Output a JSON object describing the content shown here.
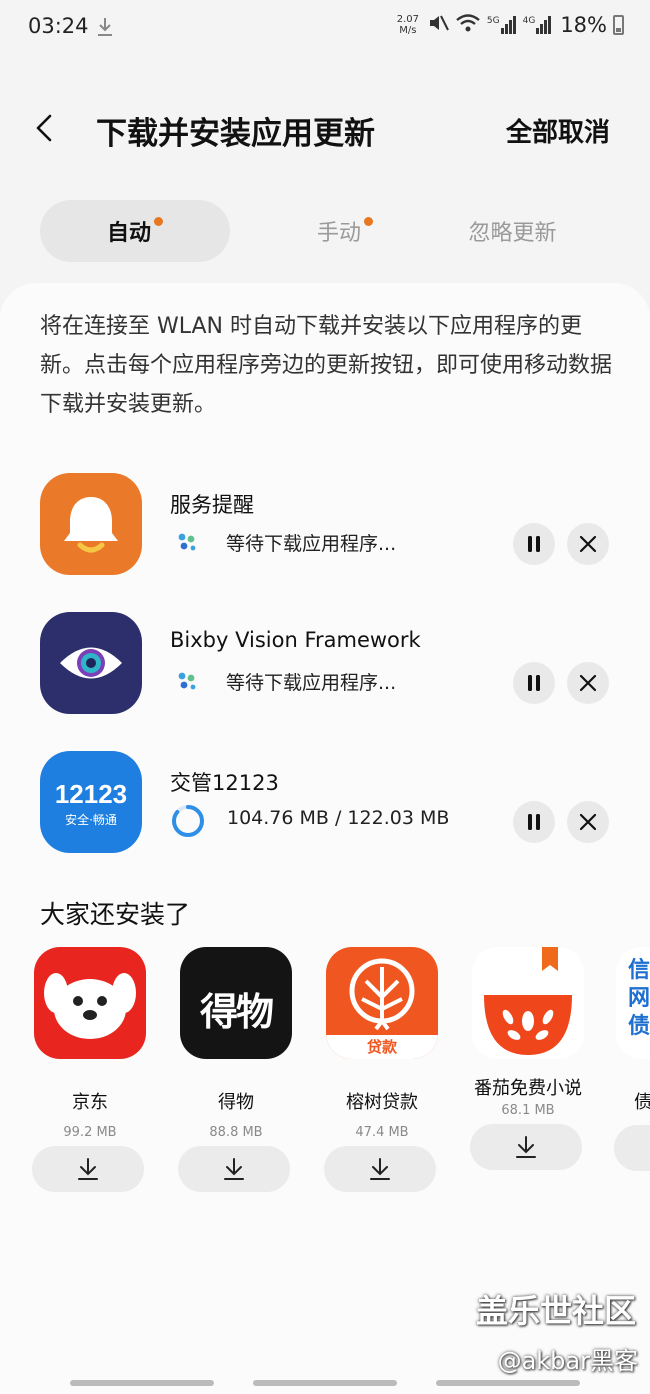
{
  "status_bar": {
    "time": "03:24",
    "speed_value": "2.07",
    "speed_unit": "M/s",
    "network_5g": "5G",
    "network_4g": "4G",
    "battery": "18%"
  },
  "header": {
    "title": "下载并安装应用更新",
    "cancel_all": "全部取消"
  },
  "tabs": [
    {
      "label": "自动",
      "active": true,
      "dot": true
    },
    {
      "label": "手动",
      "active": false,
      "dot": true
    },
    {
      "label": "忽略更新",
      "active": false,
      "dot": false
    }
  ],
  "description": "将在连接至 WLAN 时自动下载并安装以下应用程序的更新。点击每个应用程序旁边的更新按钮，即可使用移动数据下载并安装更新。",
  "updates": [
    {
      "name": "服务提醒",
      "status": "等待下载应用程序..."
    },
    {
      "name": "Bixby Vision Framework",
      "status": "等待下载应用程序..."
    },
    {
      "name": "交管12123",
      "status": "104.76 MB / 122.03 MB",
      "progress": 0.86
    }
  ],
  "icon_texts": {
    "jiaoguan_top": "12123",
    "jiaoguan_bottom": "安全·畅通",
    "dewu": "得物",
    "rongshu_badge": "贷款",
    "partial_line1": "信",
    "partial_line2": "网",
    "partial_line3": "债"
  },
  "recommend": {
    "title": "大家还安装了",
    "items": [
      {
        "name": "京东",
        "size": "99.2 MB"
      },
      {
        "name": "得物",
        "size": "88.8 MB"
      },
      {
        "name": "榕树贷款",
        "size": "47.4 MB"
      },
      {
        "name": "番茄免费小说",
        "size": "68.1 MB"
      },
      {
        "name": "债",
        "size": ""
      }
    ]
  },
  "watermark": {
    "line1": "盖乐世社区",
    "line2": "@akbar黑客"
  },
  "colors": {
    "accent_dot": "#e87722",
    "progress_blue": "#2f8fe6"
  }
}
